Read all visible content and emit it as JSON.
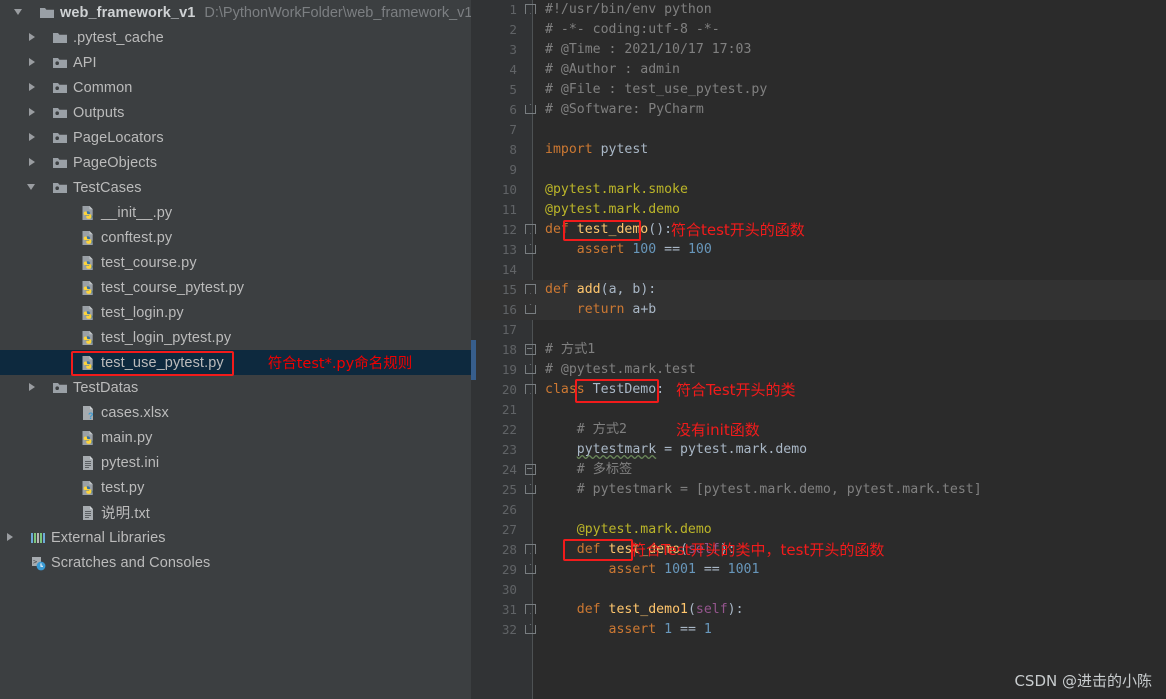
{
  "project": {
    "root": {
      "label": "web_framework_v1",
      "path_hint": "D:\\PythonWorkFolder\\web_framework_v1",
      "icon": "folder-icon",
      "arrow": "chevron-down-icon"
    },
    "items": [
      {
        "label": ".pytest_cache",
        "icon": "folder-icon",
        "arrow": "chevron-right-icon",
        "depth": 1,
        "selected": false
      },
      {
        "label": "API",
        "icon": "module-folder-icon",
        "arrow": "chevron-right-icon",
        "depth": 1,
        "selected": false
      },
      {
        "label": "Common",
        "icon": "module-folder-icon",
        "arrow": "chevron-right-icon",
        "depth": 1,
        "selected": false
      },
      {
        "label": "Outputs",
        "icon": "module-folder-icon",
        "arrow": "chevron-right-icon",
        "depth": 1,
        "selected": false
      },
      {
        "label": "PageLocators",
        "icon": "module-folder-icon",
        "arrow": "chevron-right-icon",
        "depth": 1,
        "selected": false
      },
      {
        "label": "PageObjects",
        "icon": "module-folder-icon",
        "arrow": "chevron-right-icon",
        "depth": 1,
        "selected": false
      },
      {
        "label": "TestCases",
        "icon": "module-folder-icon",
        "arrow": "chevron-down-icon",
        "depth": 1,
        "selected": false
      },
      {
        "label": "__init__.py",
        "icon": "python-file-icon",
        "arrow": "none",
        "depth": 2,
        "selected": false
      },
      {
        "label": "conftest.py",
        "icon": "python-file-icon",
        "arrow": "none",
        "depth": 2,
        "selected": false
      },
      {
        "label": "test_course.py",
        "icon": "python-file-icon",
        "arrow": "none",
        "depth": 2,
        "selected": false
      },
      {
        "label": "test_course_pytest.py",
        "icon": "python-file-icon",
        "arrow": "none",
        "depth": 2,
        "selected": false
      },
      {
        "label": "test_login.py",
        "icon": "python-file-icon",
        "arrow": "none",
        "depth": 2,
        "selected": false
      },
      {
        "label": "test_login_pytest.py",
        "icon": "python-file-icon",
        "arrow": "none",
        "depth": 2,
        "selected": false
      },
      {
        "label": "test_use_pytest.py",
        "icon": "python-file-icon",
        "arrow": "none",
        "depth": 2,
        "selected": true,
        "annotation": "符合test*.py命名规则"
      },
      {
        "label": "TestDatas",
        "icon": "module-folder-icon",
        "arrow": "chevron-right-icon",
        "depth": 1,
        "selected": false
      },
      {
        "label": "cases.xlsx",
        "icon": "unknown-file-icon",
        "arrow": "none",
        "depth": 2,
        "selected": false
      },
      {
        "label": "main.py",
        "icon": "python-file-icon",
        "arrow": "none",
        "depth": 2,
        "selected": false
      },
      {
        "label": "pytest.ini",
        "icon": "text-file-icon",
        "arrow": "none",
        "depth": 2,
        "selected": false
      },
      {
        "label": "test.py",
        "icon": "python-file-icon",
        "arrow": "none",
        "depth": 2,
        "selected": false
      },
      {
        "label": "说明.txt",
        "icon": "text-file-icon",
        "arrow": "none",
        "depth": 2,
        "selected": false
      },
      {
        "label": "External Libraries",
        "icon": "libraries-icon",
        "arrow": "chevron-right-icon",
        "depth": 0,
        "selected": false
      },
      {
        "label": "Scratches and Consoles",
        "icon": "scratches-icon",
        "arrow": "none",
        "depth": 0,
        "selected": false
      }
    ]
  },
  "editor": {
    "first_line": 1,
    "last_line": 32,
    "lines": [
      {
        "n": 1,
        "text": "#!/usr/bin/env python"
      },
      {
        "n": 2,
        "text": "# -*- coding:utf-8 -*-"
      },
      {
        "n": 3,
        "text": "# @Time : 2021/10/17 17:03"
      },
      {
        "n": 4,
        "text": "# @Author : admin"
      },
      {
        "n": 5,
        "text": "# @File : test_use_pytest.py"
      },
      {
        "n": 6,
        "text": "# @Software: PyCharm"
      },
      {
        "n": 7,
        "text": ""
      },
      {
        "n": 8,
        "text": "import pytest"
      },
      {
        "n": 9,
        "text": ""
      },
      {
        "n": 10,
        "text": "@pytest.mark.smoke"
      },
      {
        "n": 11,
        "text": "@pytest.mark.demo"
      },
      {
        "n": 12,
        "text": "def test_demo():"
      },
      {
        "n": 13,
        "text": "    assert 100 == 100"
      },
      {
        "n": 14,
        "text": ""
      },
      {
        "n": 15,
        "text": "def add(a, b):"
      },
      {
        "n": 16,
        "text": "    return a+b"
      },
      {
        "n": 17,
        "text": ""
      },
      {
        "n": 18,
        "text": "# 方式1"
      },
      {
        "n": 19,
        "text": "# @pytest.mark.test"
      },
      {
        "n": 20,
        "text": "class TestDemo:"
      },
      {
        "n": 21,
        "text": ""
      },
      {
        "n": 22,
        "text": "    # 方式2"
      },
      {
        "n": 23,
        "text": "    pytestmark = pytest.mark.demo"
      },
      {
        "n": 24,
        "text": "    # 多标签"
      },
      {
        "n": 25,
        "text": "    # pytestmark = [pytest.mark.demo, pytest.mark.test]"
      },
      {
        "n": 26,
        "text": ""
      },
      {
        "n": 27,
        "text": "    @pytest.mark.demo"
      },
      {
        "n": 28,
        "text": "    def test_demo(self):"
      },
      {
        "n": 29,
        "text": "        assert 1001 == 1001"
      },
      {
        "n": 30,
        "text": ""
      },
      {
        "n": 31,
        "text": "    def test_demo1(self):"
      },
      {
        "n": 32,
        "text": "        assert 1 == 1"
      }
    ],
    "annotations": [
      {
        "text": "符合test开头的函数",
        "line": 12
      },
      {
        "text": "符合Test开头的类",
        "line": 20
      },
      {
        "text": "没有init函数",
        "line": 22
      },
      {
        "text": "符合Test开头的类中，test开头的函数",
        "line": 28
      }
    ]
  },
  "watermark": {
    "text": "CSDN @进击的小陈"
  },
  "colors": {
    "sidebar_bg": "#3c3f41",
    "editor_bg": "#2b2b2b",
    "gutter_bg": "#313335",
    "selection_bg": "#0d293e",
    "annotation_red": "#f21b1b",
    "keyword": "#cc7832",
    "function": "#ffc66d",
    "number": "#6897bb",
    "decorator": "#bbb529",
    "comment": "#808080",
    "self_param": "#94558d",
    "default_text": "#a9b7c6"
  }
}
